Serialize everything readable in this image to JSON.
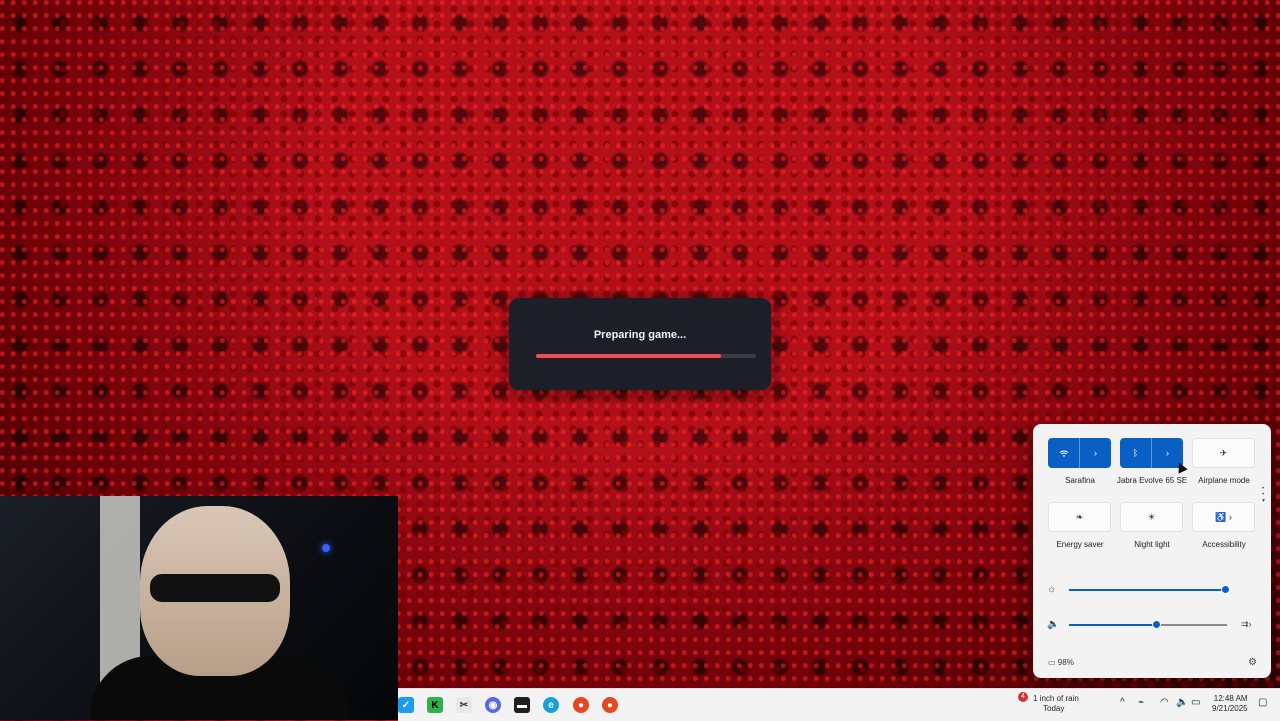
{
  "loader": {
    "text": "Preparing game...",
    "progress": 0.84
  },
  "quick_settings": {
    "tiles": [
      {
        "id": "wifi",
        "icon": "wifi-icon",
        "label": "Sarafina",
        "on": true,
        "split": true
      },
      {
        "id": "bluetooth",
        "icon": "bluetooth-icon",
        "label": "Jabra Evolve 65 SE",
        "on": true,
        "split": true
      },
      {
        "id": "airplane",
        "icon": "airplane-icon",
        "label": "Airplane mode",
        "on": false
      },
      {
        "id": "energy",
        "icon": "leaf-icon",
        "label": "Energy saver",
        "on": false
      },
      {
        "id": "night",
        "icon": "night-light-icon",
        "label": "Night light",
        "on": false
      },
      {
        "id": "accessibility",
        "icon": "accessibility-icon",
        "label": "Accessibility",
        "on": false
      }
    ],
    "brightness": 0.99,
    "volume": 0.55,
    "battery": "98%"
  },
  "taskbar": {
    "weather": {
      "line1": "1 inch of rain",
      "line2": "Today",
      "badge": "4"
    },
    "clock": {
      "time": "12:48 AM",
      "date": "9/21/2025"
    }
  },
  "colors": {
    "accent": "#0a5fc4",
    "progress": "#ef4e4e"
  }
}
